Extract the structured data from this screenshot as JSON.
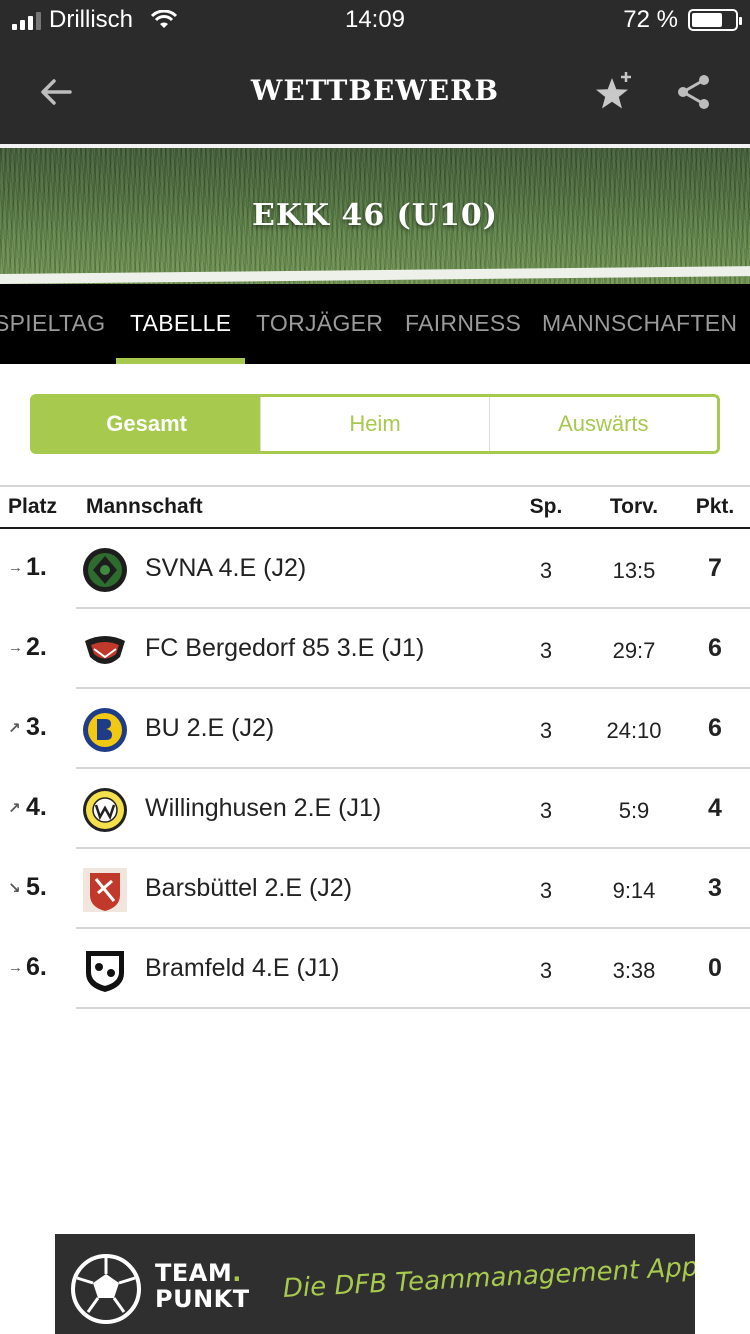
{
  "status": {
    "carrier": "Drillisch",
    "time": "14:09",
    "battery": "72 %",
    "battery_level": 0.72
  },
  "header": {
    "title": "WETTBEWERB"
  },
  "hero": {
    "title": "EKK 46 (U10)"
  },
  "tabs": [
    {
      "label": "SPIELTAG",
      "active": false
    },
    {
      "label": "TABELLE",
      "active": true
    },
    {
      "label": "TORJÄGER",
      "active": false
    },
    {
      "label": "FAIRNESS",
      "active": false
    },
    {
      "label": "MANNSCHAFTEN",
      "active": false
    }
  ],
  "segment": {
    "options": [
      "Gesamt",
      "Heim",
      "Auswärts"
    ],
    "selected": "Gesamt"
  },
  "table": {
    "headers": {
      "place": "Platz",
      "team": "Mannschaft",
      "games": "Sp.",
      "goals": "Torv.",
      "points": "Pkt."
    },
    "rows": [
      {
        "rank": "1.",
        "trend": "→",
        "team": "SVNA 4.E (J2)",
        "games": "3",
        "goals": "13:5",
        "points": "7",
        "logo": "svna-logo"
      },
      {
        "rank": "2.",
        "trend": "→",
        "team": "FC Bergedorf 85 3.E (J1)",
        "games": "3",
        "goals": "29:7",
        "points": "6",
        "logo": "bergedorf-logo"
      },
      {
        "rank": "3.",
        "trend": "↗",
        "team": "BU 2.E (J2)",
        "games": "3",
        "goals": "24:10",
        "points": "6",
        "logo": "bu-logo"
      },
      {
        "rank": "4.",
        "trend": "↗",
        "team": "Willinghusen 2.E (J1)",
        "games": "3",
        "goals": "5:9",
        "points": "4",
        "logo": "willinghusen-logo"
      },
      {
        "rank": "5.",
        "trend": "↘",
        "team": "Barsbüttel 2.E (J2)",
        "games": "3",
        "goals": "9:14",
        "points": "3",
        "logo": "barsbuettel-logo"
      },
      {
        "rank": "6.",
        "trend": "→",
        "team": "Bramfeld 4.E (J1)",
        "games": "3",
        "goals": "3:38",
        "points": "0",
        "logo": "bramfeld-logo"
      }
    ]
  },
  "banner": {
    "brand_line1": "TEAM",
    "brand_dot": ".",
    "brand_line2": "PUNKT",
    "tagline": "Die DFB Teammanagement App"
  },
  "colors": {
    "accent": "#a6c94e",
    "header_bg": "#2b2b2b",
    "tab_bg": "#000000"
  }
}
